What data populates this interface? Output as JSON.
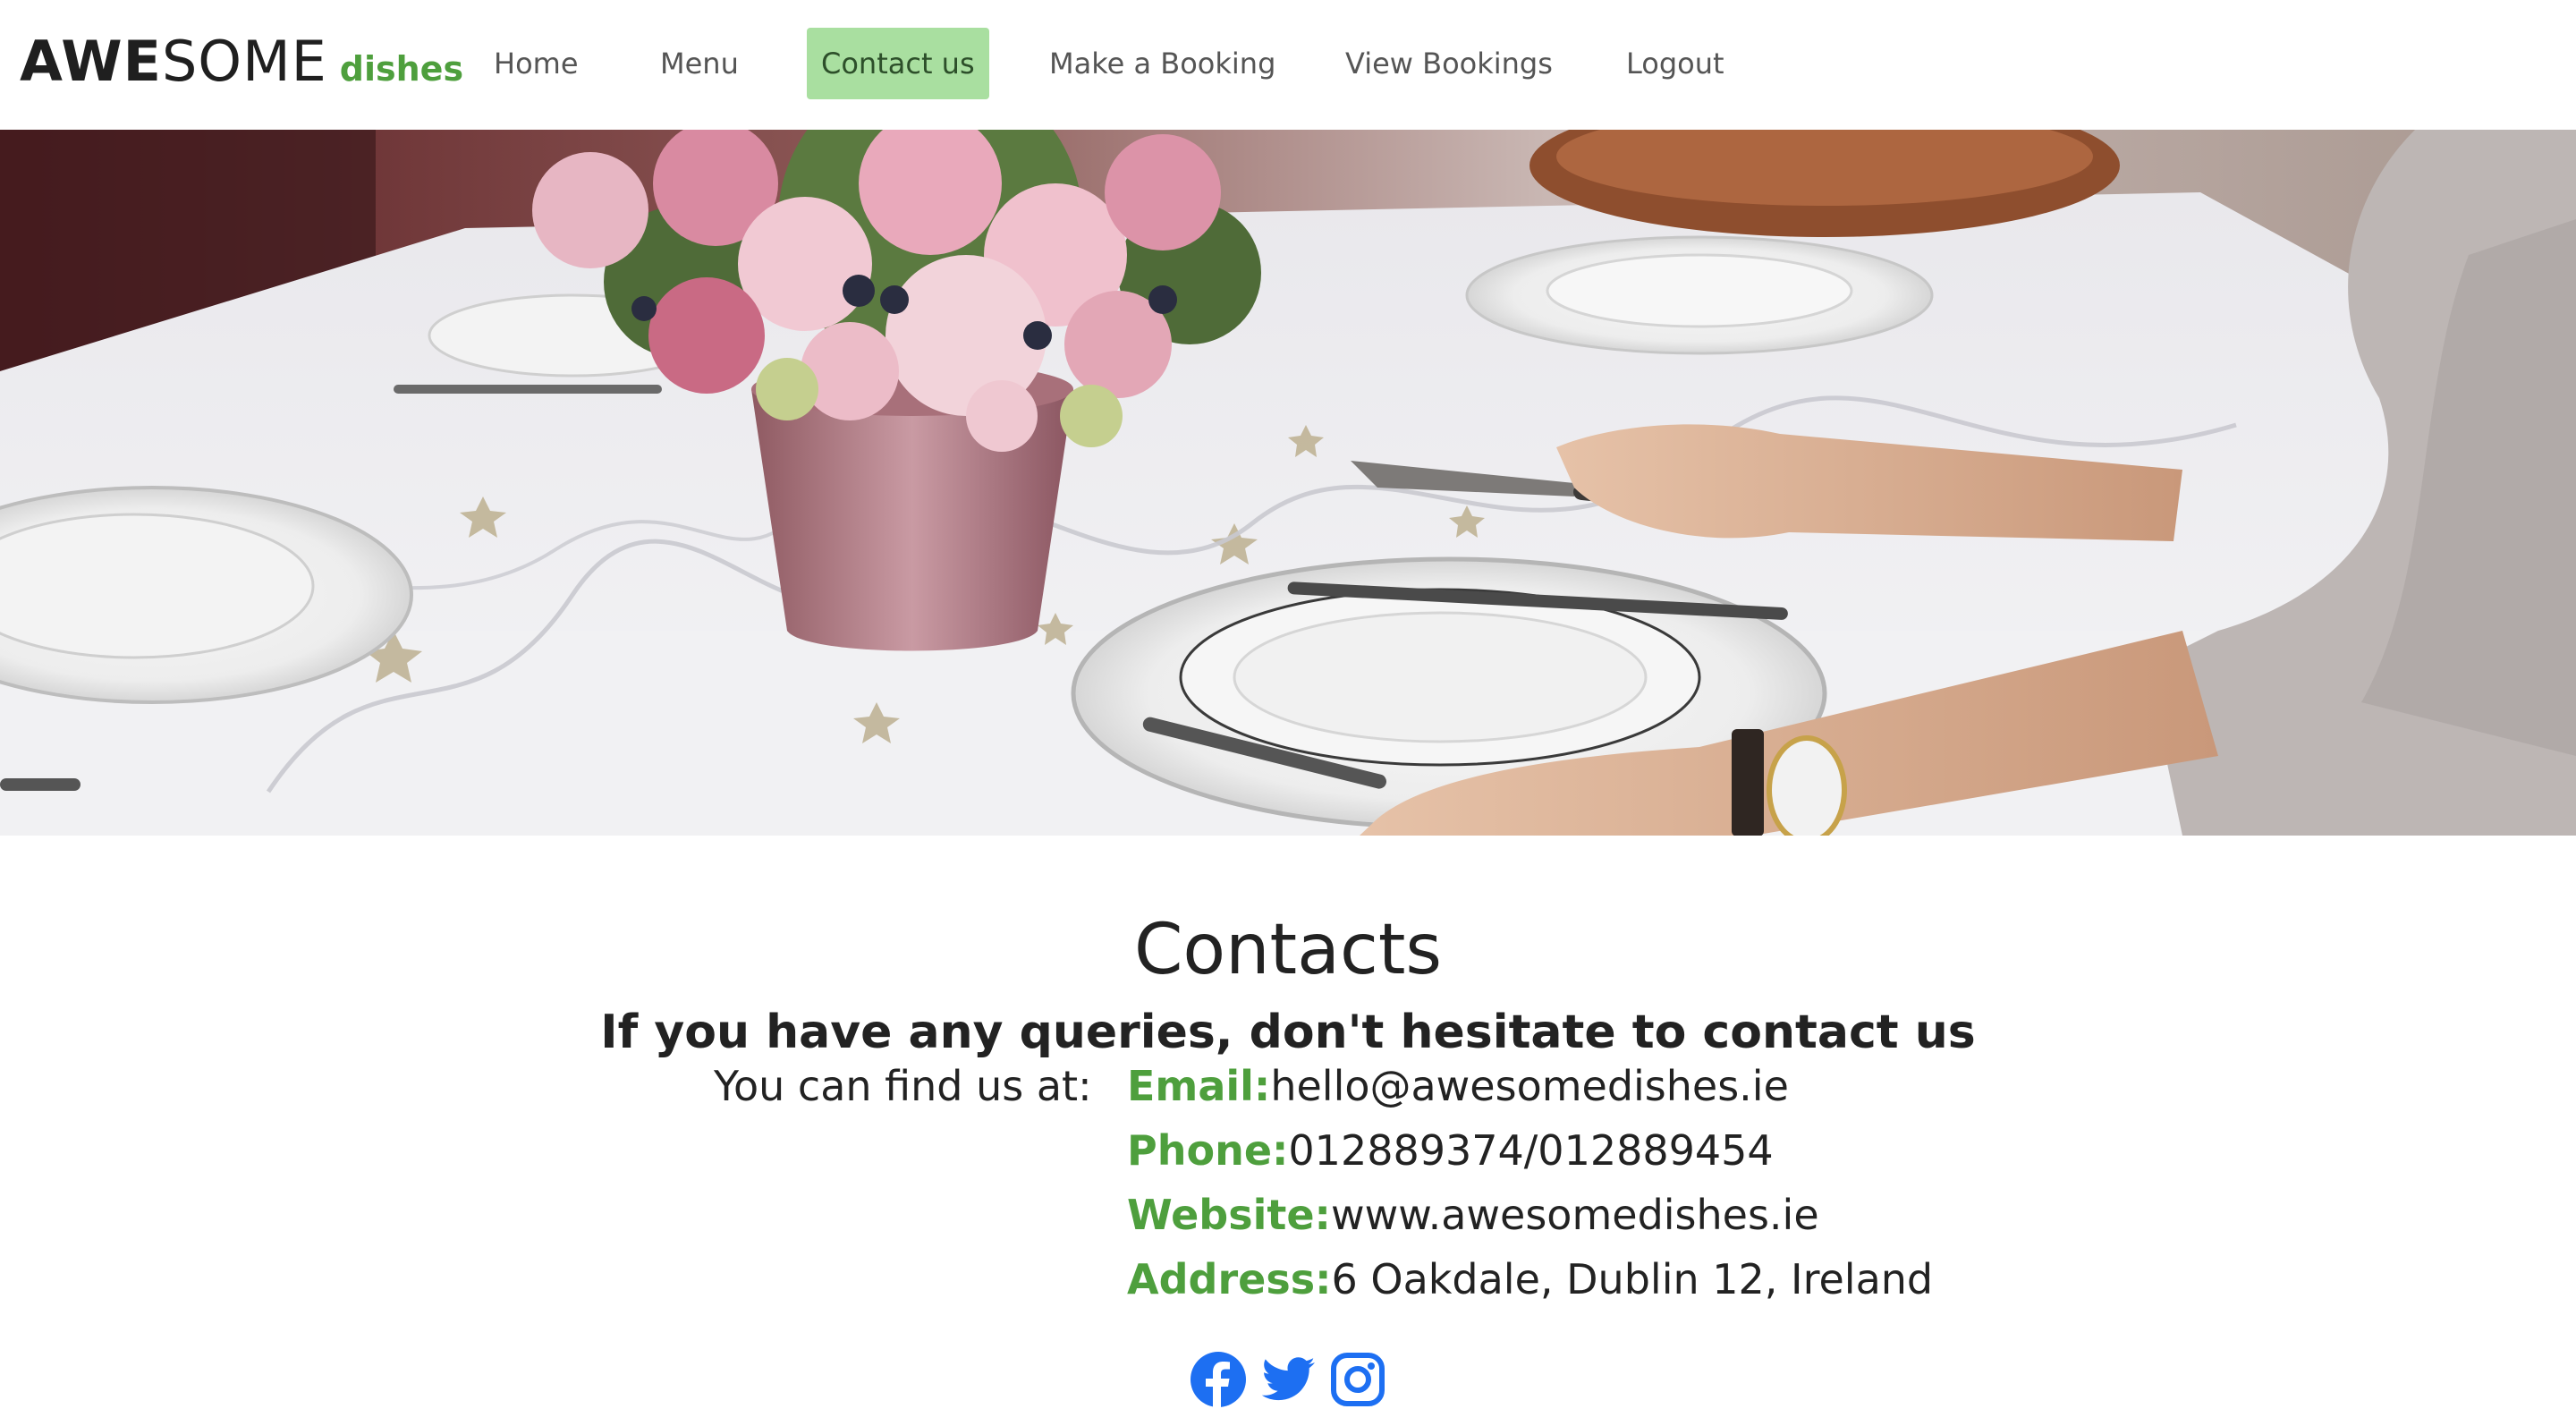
{
  "brand": {
    "part_bold": "AWE",
    "part_light": "SOME",
    "tagline": "dishes"
  },
  "nav": {
    "items": [
      {
        "label": "Home",
        "active": false
      },
      {
        "label": "Menu",
        "active": false
      },
      {
        "label": "Contact us",
        "active": true
      },
      {
        "label": "Make a Booking",
        "active": false
      },
      {
        "label": "View Bookings",
        "active": false
      },
      {
        "label": "Logout",
        "active": false
      }
    ]
  },
  "hero": {
    "image_subject": "dining-table-setting-photo"
  },
  "contacts": {
    "title": "Contacts",
    "subtitle": "If you have any queries, don't hesitate to contact us",
    "find_label": "You can find us at:",
    "email_key": "Email:",
    "email_value": "hello@awesomedishes.ie",
    "phone_key": "Phone:",
    "phone_value": "012889374/012889454",
    "website_key": "Website:",
    "website_value": "www.awesomedishes.ie",
    "address_key": "Address:",
    "address_value": "6 Oakdale, Dublin 12, Ireland"
  },
  "social": {
    "icons": [
      "facebook-icon",
      "twitter-icon",
      "instagram-icon"
    ]
  },
  "colors": {
    "accent_green": "#4e9f3d",
    "active_nav_bg": "#a9dfa0",
    "social_blue": "#1d6ff2",
    "text_dark": "#222222"
  }
}
